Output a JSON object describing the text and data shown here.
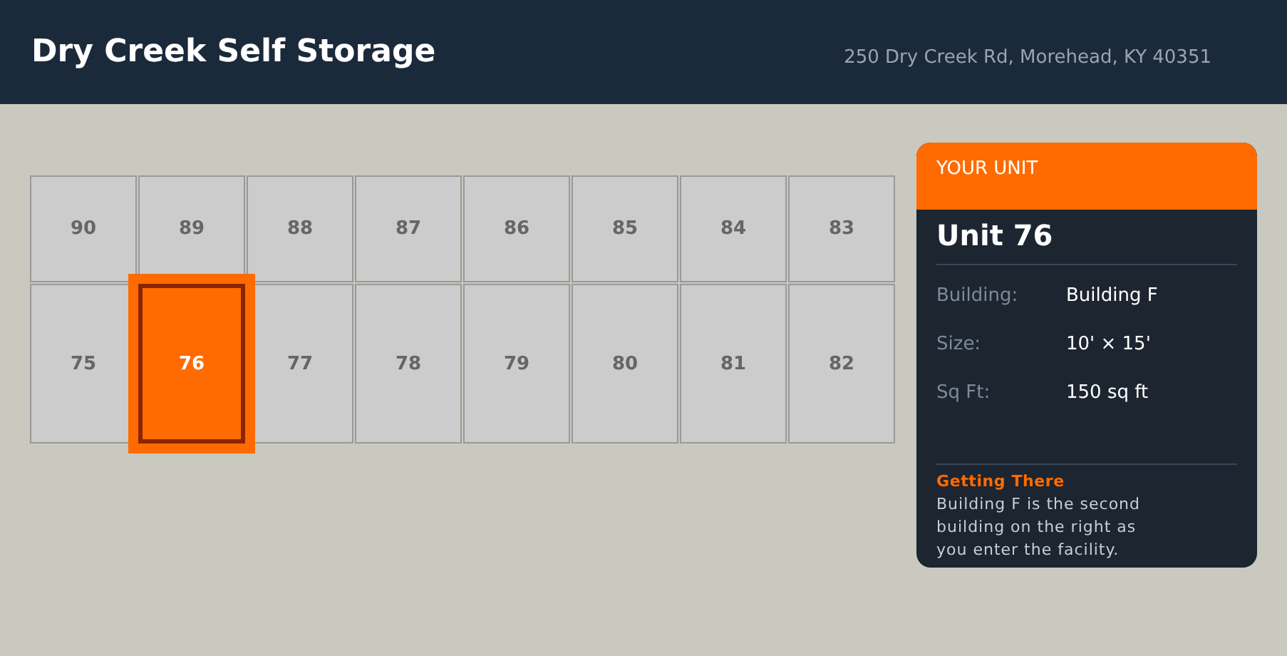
{
  "header": {
    "title": "Dry Creek Self Storage",
    "address": "250 Dry Creek Rd, Morehead, KY 40351"
  },
  "units": [
    [
      {
        "number": "90",
        "selected": false
      },
      {
        "number": "89",
        "selected": false
      },
      {
        "number": "88",
        "selected": false
      },
      {
        "number": "87",
        "selected": false
      },
      {
        "number": "86",
        "selected": false
      },
      {
        "number": "85",
        "selected": false
      },
      {
        "number": "84",
        "selected": false
      },
      {
        "number": "83",
        "selected": false
      }
    ],
    [
      {
        "number": "75",
        "selected": false
      },
      {
        "number": "76",
        "selected": true
      },
      {
        "number": "77",
        "selected": false
      },
      {
        "number": "78",
        "selected": false
      },
      {
        "number": "79",
        "selected": false
      },
      {
        "number": "80",
        "selected": false
      },
      {
        "number": "81",
        "selected": false
      },
      {
        "number": "82",
        "selected": false
      }
    ]
  ],
  "card": {
    "label": "YOUR UNIT",
    "unit": "Unit 76",
    "details": [
      {
        "label": "Building:",
        "value": "Building F"
      },
      {
        "label": "Size:",
        "value": "10' × 15'"
      },
      {
        "label": "Sq Ft:",
        "value": "150 sq ft"
      }
    ],
    "directions_title": "Getting There",
    "directions": "Building F is the second building on the right as you enter the facility."
  }
}
